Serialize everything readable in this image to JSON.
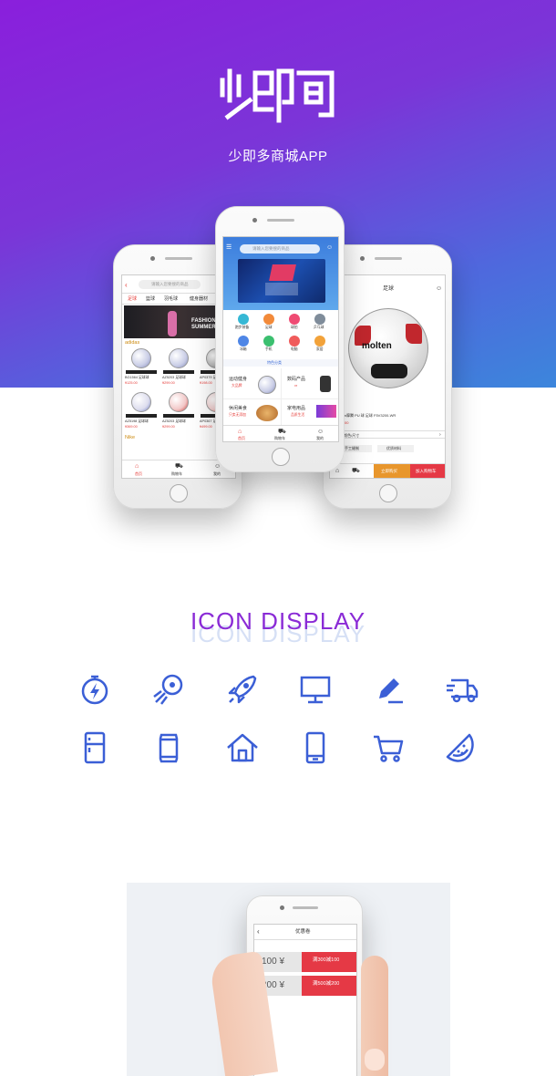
{
  "header": {
    "logo_text": "少即多",
    "subtitle": "少即多商城APP"
  },
  "left_phone": {
    "search_placeholder": "请输入您要搜的商品",
    "tabs": [
      "足球",
      "篮球",
      "羽毛球",
      "健身器材"
    ],
    "banner": {
      "brand": "adidas",
      "line1": "FASHION",
      "line2": "SUMMER"
    },
    "section_brand": "adidas",
    "products": [
      {
        "name": "BG1564 足球球",
        "price": "¥125.00"
      },
      {
        "name": "AZ5203 足球球",
        "price": "¥299.00"
      },
      {
        "name": "AP0379 足球球",
        "price": "¥198.00"
      },
      {
        "name": "AZ5198 足球球",
        "price": "¥369.00"
      },
      {
        "name": "AZ5203 足球球",
        "price": "¥299.00"
      },
      {
        "name": "AP0367 足球球",
        "price": "¥499.00"
      }
    ],
    "section_brand2": "Nike",
    "tabbar": [
      "首页",
      "购物车",
      "我的"
    ]
  },
  "center_phone": {
    "search_placeholder": "请输入您要搜的商品",
    "categories": [
      "跑步装备",
      "足球",
      "球拍",
      "乒乓球",
      "冰箱",
      "手机",
      "电脑",
      "家居"
    ],
    "special_label": "特色分类",
    "cards": [
      {
        "title": "运动健身",
        "sub": "大品牌"
      },
      {
        "title": "数码产品",
        "sub": "vr"
      },
      {
        "title": "休闲美食",
        "sub": "只卖无添加"
      },
      {
        "title": "家电用品",
        "sub": "品质生活"
      }
    ],
    "tabbar": [
      "首页",
      "购物车",
      "我的"
    ]
  },
  "right_phone": {
    "title": "足球",
    "brand": "molten",
    "product_desc": "molten摩腾 PU 球 足球 F5V3200-WR",
    "price": "¥138.00",
    "spec_label": "选择 颜色/尺寸",
    "tags": [
      "手工缝制",
      "优质材料"
    ],
    "buy_now": "立即购买",
    "add_cart": "加入购物车"
  },
  "icons_section": {
    "title": "ICON  DISPLAY",
    "icons": [
      "stopwatch-icon",
      "football-icon",
      "rocket-icon",
      "monitor-icon",
      "pen-icon",
      "truck-icon",
      "fridge-icon",
      "can-icon",
      "house-icon",
      "phone-icon",
      "cart-icon",
      "watermelon-icon"
    ]
  },
  "coupon_phone": {
    "title": "优惠卷",
    "coupons": [
      {
        "amount": "100 ¥",
        "rule": "满300减100"
      },
      {
        "amount": "200 ¥",
        "rule": "满500减200"
      }
    ]
  },
  "colors": {
    "brand_purple": "#8a1fdc",
    "accent_blue": "#3b5fd6",
    "accent_red": "#e53945"
  }
}
